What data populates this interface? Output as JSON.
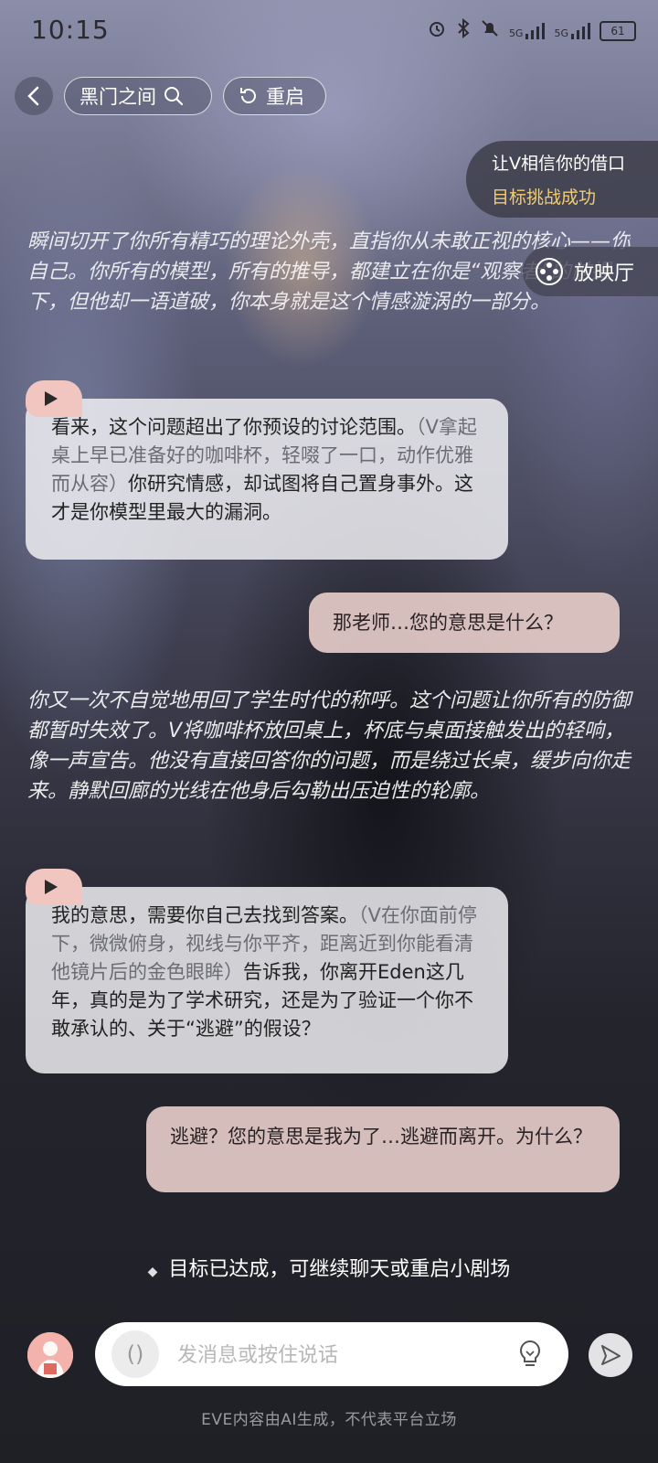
{
  "status_bar": {
    "time": "10:15",
    "battery": "61",
    "net1": "5G",
    "net2": "5G"
  },
  "header": {
    "back_icon": "chevron-left-icon",
    "scene_title": "黑门之间",
    "restart_label": "重启"
  },
  "goal_card": {
    "title": "让V相信你的借口",
    "status": "目标挑战成功",
    "status_color": "#f2cc6e"
  },
  "cinema_button": {
    "label": "放映厅"
  },
  "messages": {
    "narration_1": "瞬间切开了你所有精巧的理论外壳，直指你从未敢正视的核心——你自己。你所有的模型，所有的推导，都建立在你是“观察者”的前提下，但他却一语道破，你本身就是这个情感漩涡的一部分。",
    "ai_1_line": "看来，这个问题超出了你预设的讨论范围。",
    "ai_1_action": "（V拿起桌上早已准备好的咖啡杯，轻啜了一口，动作优雅而从容）",
    "ai_1_rest": "你研究情感，却试图将自己置身事外。这才是你模型里最大的漏洞。",
    "user_1": "那老师…您的意思是什么？",
    "narration_2": "你又一次不自觉地用回了学生时代的称呼。这个问题让你所有的防御都暂时失效了。V将咖啡杯放回桌上，杯底与桌面接触发出的轻响，像一声宣告。他没有直接回答你的问题，而是绕过长桌，缓步向你走来。静默回廊的光线在他身后勾勒出压迫性的轮廓。",
    "ai_2_line": "我的意思，需要你自己去找到答案。",
    "ai_2_action": "（V在你面前停下，微微俯身，视线与你平齐，距离近到你能看清他镜片后的金色眼眸）",
    "ai_2_rest": "告诉我，你离开Eden这几年，真的是为了学术研究，还是为了验证一个你不敢承认的、关于“逃避”的假设？",
    "user_2": "逃避？您的意思是我为了…逃避而离开。为什么？"
  },
  "goal_tip": "目标已达成，可继续聊天或重启小剧场",
  "input": {
    "placeholder": "发消息或按住说话",
    "voice_glyph": "()"
  },
  "disclaimer": "EVE内容由AI生成，不代表平台立场",
  "colors": {
    "play_tab": "#f2c6c0",
    "user_bubble": "#e8ceca",
    "ai_bubble": "#eeeef2"
  }
}
